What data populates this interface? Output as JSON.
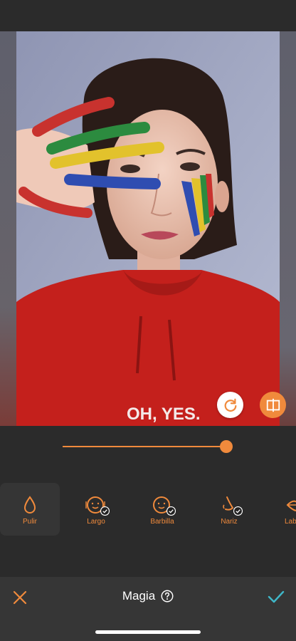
{
  "photo": {
    "shirt_text": "OH, YES."
  },
  "slider": {
    "value": 0.96
  },
  "tools": [
    {
      "label": "Pulir",
      "icon": "drop-icon",
      "active": true
    },
    {
      "label": "Largo",
      "icon": "face-length-icon",
      "badge": "check-icon"
    },
    {
      "label": "Barbilla",
      "icon": "face-chin-icon",
      "badge": "check-icon"
    },
    {
      "label": "Nariz",
      "icon": "nose-icon",
      "badge": "check-icon"
    },
    {
      "label": "Labios",
      "icon": "lips-icon"
    }
  ],
  "footer": {
    "title": "Magia",
    "help_icon": "question-circle-icon",
    "cancel_icon": "close-icon",
    "confirm_icon": "check-icon"
  },
  "colors": {
    "accent": "#f08a3c",
    "confirm": "#3fb8c9",
    "background": "#2b2b2b"
  }
}
